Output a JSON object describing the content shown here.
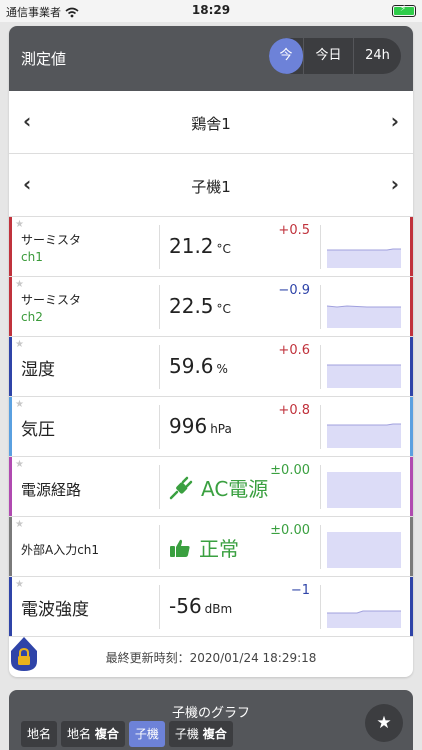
{
  "status_bar": {
    "carrier": "通信事業者",
    "time": "18:29"
  },
  "header": {
    "title": "測定値",
    "segments": {
      "now": "今",
      "today": "今日",
      "h24": "24h"
    }
  },
  "nav": {
    "site": "鶏舎1",
    "unit": "子機1"
  },
  "rows": [
    {
      "name": "サーミスタ",
      "sub": "ch1",
      "value": "21.2",
      "unit": "°C",
      "delta": "+0.5",
      "color": "#c0323c"
    },
    {
      "name": "サーミスタ",
      "sub": "ch2",
      "value": "22.5",
      "unit": "°C",
      "delta": "−0.9",
      "color": "#c0323c"
    },
    {
      "name": "湿度",
      "value": "59.6",
      "unit": "%",
      "delta": "+0.6",
      "color": "#2f44a8"
    },
    {
      "name": "気圧",
      "value": "996",
      "unit": "hPa",
      "delta": "+0.8",
      "color": "#5aa0e0"
    },
    {
      "name": "電源経路",
      "status": "AC電源",
      "status_icon": "plug-icon",
      "delta": "±0.00",
      "color": "#b04ab0"
    },
    {
      "name": "外部A入力ch1",
      "status": "正常",
      "status_icon": "thumbs-up-icon",
      "delta": "±0.00",
      "color": "#7a7a7a"
    },
    {
      "name": "電波強度",
      "value": "-56",
      "unit": "dBm",
      "delta": "−1",
      "color": "#2f44a8"
    }
  ],
  "footer": {
    "updated": "最終更新時刻：2020/01/24 18:29:18"
  },
  "graph": {
    "title": "子機のグラフ",
    "tabs": [
      {
        "a": "地名",
        "b": ""
      },
      {
        "a": "地名",
        "b": "複合"
      },
      {
        "a": "子機",
        "b": ""
      },
      {
        "a": "子機",
        "b": "複合"
      }
    ]
  },
  "colors": {
    "accent": "#6d82d8",
    "header_bg": "#54565a",
    "positive": "#c0323c",
    "negative": "#2f44a8",
    "ok": "#3aa040",
    "spark_fill": "#dcdcf7"
  }
}
